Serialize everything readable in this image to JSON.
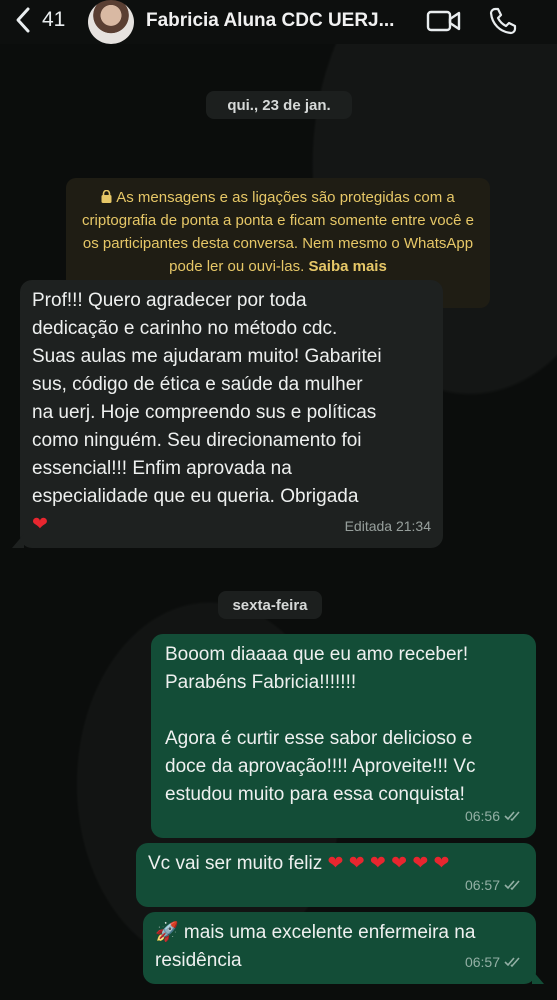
{
  "header": {
    "back_count": "41",
    "title": "Fabricia Aluna CDC UERJ..."
  },
  "chat": {
    "date1": "qui., 23 de jan.",
    "encryption_notice": "As mensagens e as ligações são protegidas com a criptografia de ponta a ponta e ficam somente entre você e os participantes desta conversa. Nem mesmo o WhatsApp pode ler ou ouvi-las.",
    "learn_more": "Saiba mais",
    "date2": "sexta-feira",
    "messages": [
      {
        "direction": "incoming",
        "text": "Prof!!! Quero agradecer por toda\ndedicação e carinho no método cdc.\nSuas aulas me ajudaram muito! Gabaritei\nsus, código de ética e saúde da mulher\nna uerj. Hoje compreendo sus e políticas\ncomo ninguém. Seu direcionamento foi\nessencial!!! Enfim aprovada na\nespecialidade que eu queria. Obrigada\n❤",
        "meta": "Editada 21:34"
      },
      {
        "direction": "outgoing",
        "text": "Booom diaaaa que eu amo receber!\nParabéns Fabricia!!!!!!!\n\nAgora é curtir esse sabor delicioso e\ndoce da aprovação!!!! Aproveite!!! Vc\nestudou muito para essa conquista!",
        "time": "06:56"
      },
      {
        "direction": "outgoing",
        "text": "Vc vai ser muito feliz ❤ ❤ ❤ ❤ ❤ ❤",
        "time": "06:57"
      },
      {
        "direction": "outgoing",
        "text": "🚀 mais uma excelente enfermeira na\nresidência",
        "time": "06:57"
      }
    ]
  }
}
